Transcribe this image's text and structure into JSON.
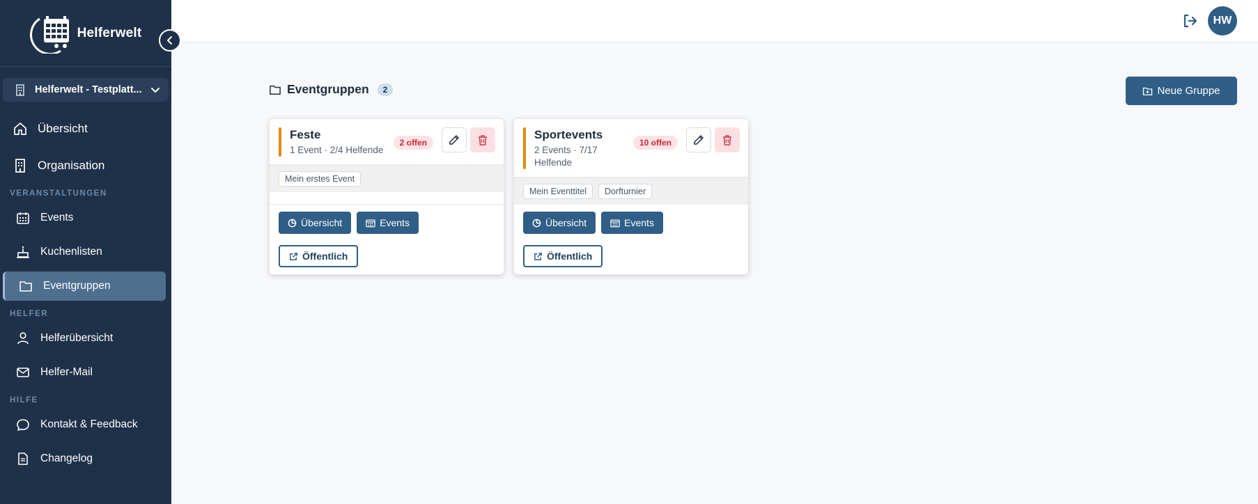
{
  "app": {
    "name": "Helferwelt"
  },
  "sidebar": {
    "org_name": "Helferwelt - Testplatt...",
    "main_items": [
      {
        "label": "Übersicht",
        "icon": "home-icon"
      },
      {
        "label": "Organisation",
        "icon": "building-icon"
      }
    ],
    "sections": {
      "events_title": "VERANSTALTUNGEN",
      "helpers_title": "HELFER",
      "help_title": "HILFE"
    },
    "event_items": [
      {
        "label": "Events",
        "icon": "calendar-icon"
      },
      {
        "label": "Kuchenlisten",
        "icon": "cake-icon"
      },
      {
        "label": "Eventgruppen",
        "icon": "folder-icon",
        "active": true
      }
    ],
    "helper_items": [
      {
        "label": "Helferübersicht",
        "icon": "user-icon"
      },
      {
        "label": "Helfer-Mail",
        "icon": "mail-icon"
      }
    ],
    "help_items": [
      {
        "label": "Kontakt & Feedback",
        "icon": "chat-icon"
      },
      {
        "label": "Changelog",
        "icon": "document-icon"
      }
    ]
  },
  "topbar": {
    "avatar_initials": "HW"
  },
  "main": {
    "title": "Eventgruppen",
    "count": "2",
    "new_group_label": "Neue Gruppe",
    "groups": [
      {
        "name": "Feste",
        "meta": "1 Event · 2/4 Helfende",
        "open_badge": "2 offen",
        "tags": [
          "Mein erstes Event"
        ],
        "btn_overview": "Übersicht",
        "btn_events": "Events",
        "btn_public": "Öffentlich"
      },
      {
        "name": "Sportevents",
        "meta_line1": "2 Events · 7/17",
        "meta_line2": "Helfende",
        "open_badge": "10 offen",
        "tags": [
          "Mein Eventtitel",
          "Dorfturnier"
        ],
        "btn_overview": "Übersicht",
        "btn_events": "Events",
        "btn_public": "Öffentlich"
      }
    ]
  },
  "colors": {
    "sidebar_bg": "#1f3149",
    "primary": "#2f5e87",
    "accent_orange": "#e18a12",
    "danger": "#c8283a"
  }
}
